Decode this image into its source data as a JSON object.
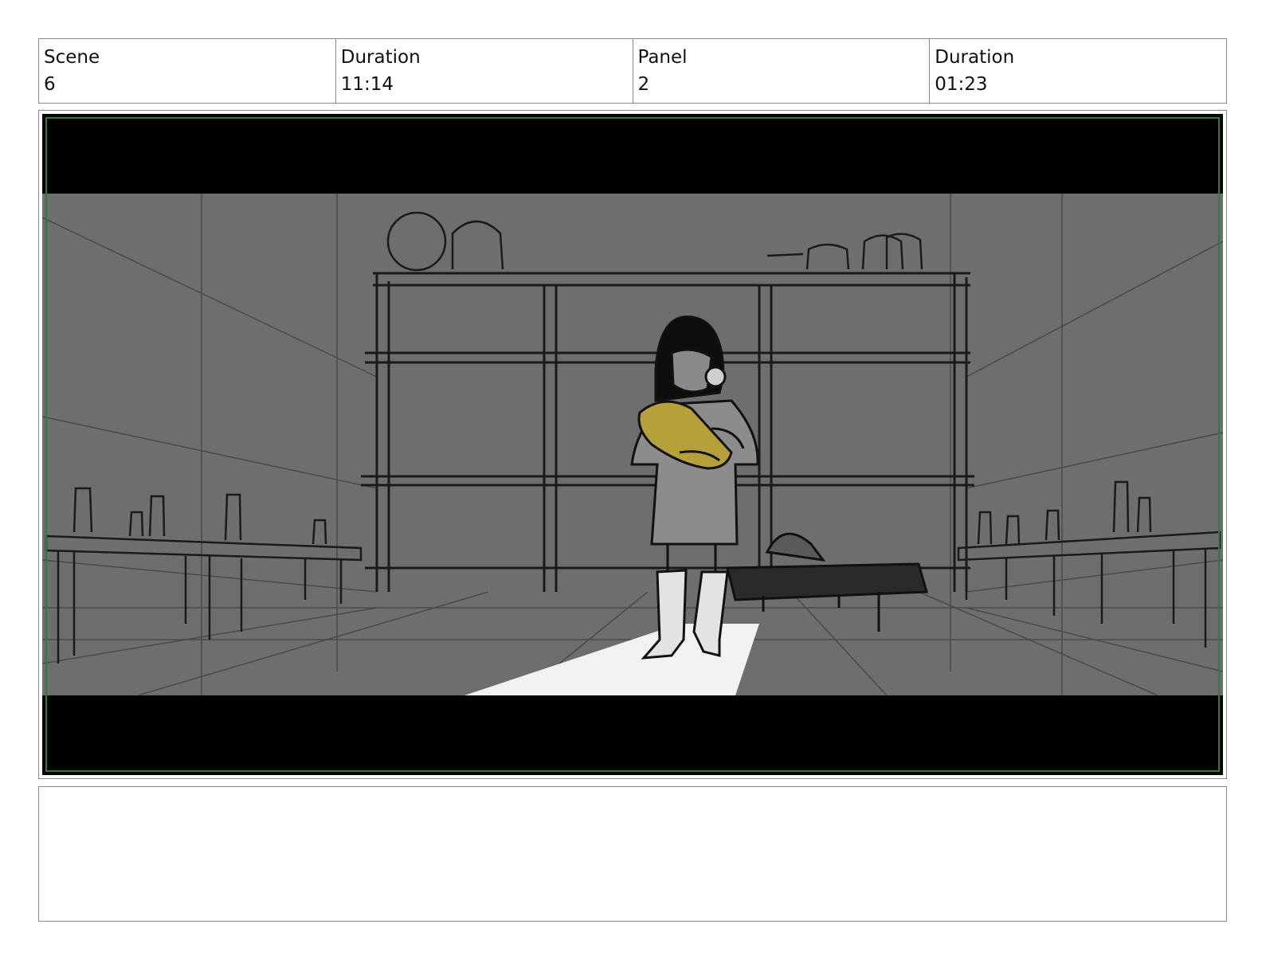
{
  "header": {
    "scene_label": "Scene",
    "scene_value": "6",
    "scene_duration_label": "Duration",
    "scene_duration_value": "11:14",
    "panel_label": "Panel",
    "panel_value": "2",
    "panel_duration_label": "Duration",
    "panel_duration_value": "01:23"
  },
  "colors": {
    "letterbox": "#000000",
    "background_gray": "#6e6e6e",
    "safe_frame": "#2e7d32",
    "baby_blanket": "#b5a03a",
    "light_beam": "#f2f2f2"
  },
  "notes": {
    "text": ""
  }
}
